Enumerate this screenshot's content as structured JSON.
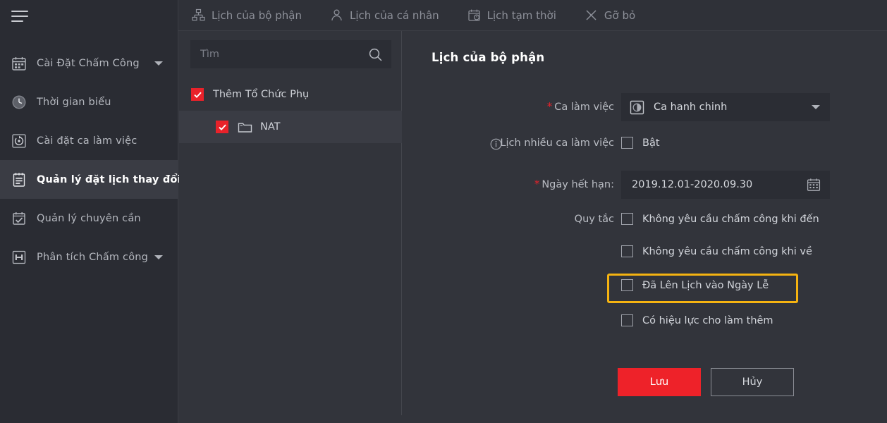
{
  "sidebar": {
    "menu_icon": "hamburger-icon",
    "items": [
      {
        "icon": "calendar-settings-icon",
        "label": "Cài Đặt Chấm Công",
        "caret": true,
        "active": false
      },
      {
        "icon": "clock-icon",
        "label": "Thời gian biểu",
        "caret": false,
        "active": false
      },
      {
        "icon": "shift-settings-icon",
        "label": "Cài đặt ca làm việc",
        "caret": false,
        "active": false
      },
      {
        "icon": "schedule-list-icon",
        "label": "Quản lý đặt lịch thay đổi",
        "caret": false,
        "active": true
      },
      {
        "icon": "calendar-check-icon",
        "label": "Quản lý chuyên cần",
        "caret": false,
        "active": false
      },
      {
        "icon": "analytics-icon",
        "label": "Phân tích Chấm công",
        "caret": true,
        "active": false
      }
    ]
  },
  "tabs": [
    {
      "icon": "org-chart-icon",
      "label": "Lịch của bộ phận"
    },
    {
      "icon": "person-icon",
      "label": "Lịch của cá nhân"
    },
    {
      "icon": "calendar-temp-icon",
      "label": "Lịch tạm thời"
    },
    {
      "icon": "close-x-icon",
      "label": "Gỡ bỏ"
    }
  ],
  "tree_panel": {
    "search": {
      "value": "",
      "placeholder": "Tìm",
      "icon": "search-icon"
    },
    "nodes": [
      {
        "label": "Thêm Tổ Chức Phụ",
        "checked": true,
        "level": 0,
        "selected": false,
        "folder": false
      },
      {
        "label": "NAT",
        "checked": true,
        "level": 1,
        "selected": true,
        "folder": true
      }
    ]
  },
  "form": {
    "title": "Lịch của bộ phận",
    "shift": {
      "label": "Ca làm việc",
      "required": true,
      "value": "Ca hanh chinh",
      "icon": "shift-badge-icon",
      "caret_icon": "chevron-down-icon"
    },
    "multi_shift": {
      "label": "Lịch nhiều ca làm việc",
      "info_icon": "info-icon",
      "checkbox_label": "Bật",
      "checked": false
    },
    "expiry": {
      "label": "Ngày hết hạn:",
      "required": true,
      "value": "2019.12.01-2020.09.30",
      "icon": "calendar-icon"
    },
    "rules": {
      "label": "Quy tắc",
      "options": [
        {
          "label": "Không yêu cầu chấm công khi đến",
          "checked": false,
          "highlighted": false
        },
        {
          "label": "Không yêu cầu chấm công khi về",
          "checked": false,
          "highlighted": false
        },
        {
          "label": "Đã Lên Lịch vào Ngày Lễ",
          "checked": false,
          "highlighted": true
        },
        {
          "label": "Có hiệu lực cho làm thêm",
          "checked": false,
          "highlighted": false
        }
      ]
    },
    "buttons": {
      "save": "Lưu",
      "cancel": "Hủy"
    }
  },
  "colors": {
    "accent_red": "#ee2229",
    "highlight_yellow": "#f5b311",
    "panel_bg": "#32343b",
    "sidebar_bg": "#2a2c33",
    "input_bg": "#2b2d34"
  }
}
